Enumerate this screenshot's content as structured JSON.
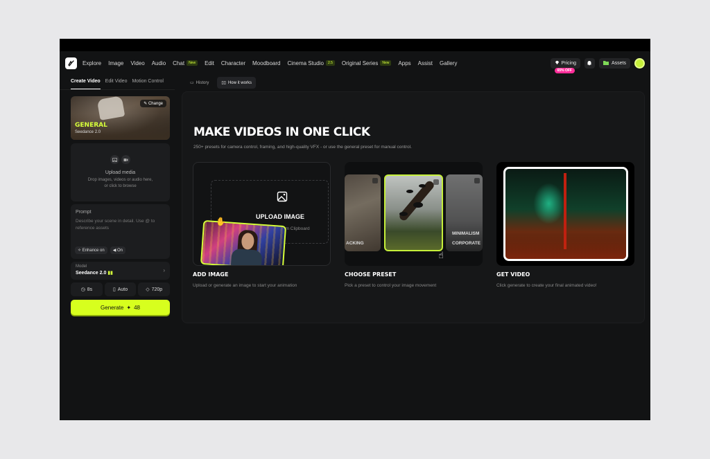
{
  "nav": {
    "items": [
      {
        "label": "Explore"
      },
      {
        "label": "Image"
      },
      {
        "label": "Video"
      },
      {
        "label": "Audio"
      },
      {
        "label": "Chat",
        "badge": "New"
      },
      {
        "label": "Edit"
      },
      {
        "label": "Character"
      },
      {
        "label": "Moodboard"
      },
      {
        "label": "Cinema Studio",
        "badge": "2.5"
      },
      {
        "label": "Original Series",
        "badge": "New"
      },
      {
        "label": "Apps"
      },
      {
        "label": "Assist"
      },
      {
        "label": "Gallery"
      }
    ],
    "pricing_label": "Pricing",
    "pricing_badge": "65% OFF",
    "assets_label": "Assets"
  },
  "sidebar": {
    "tabs": [
      "Create Video",
      "Edit Video",
      "Motion Control"
    ],
    "preset": {
      "change_label": "Change",
      "name": "GENERAL",
      "model": "Seedance 2.0"
    },
    "upload": {
      "title": "Upload media",
      "sub1": "Drop images, videos or audio here,",
      "sub2": "or click to browse"
    },
    "prompt": {
      "label": "Prompt",
      "placeholder": "Describe your scene in detail. Use @ to reference assets",
      "enhance_label": "Enhance on",
      "toggle_label": "On"
    },
    "model": {
      "label": "Model",
      "value": "Seedance 2.0"
    },
    "options": {
      "duration": "8s",
      "aspect": "Auto",
      "resolution": "720p"
    },
    "generate": {
      "label": "Generate",
      "cost": "48"
    }
  },
  "toolbar": {
    "history_label": "History",
    "how_label": "How it works"
  },
  "hero": {
    "title": "MAKE VIDEOS IN ONE CLICK",
    "subtitle": "250+ presets for camera control, framing, and high-quality VFX - or use the general preset for manual control."
  },
  "steps": {
    "upload": {
      "card_title": "UPLOAD IMAGE",
      "card_sub": "from Clipboard",
      "title": "ADD IMAGE",
      "sub": "Upload or generate an image to start your animation"
    },
    "preset": {
      "left_label": "ACKING",
      "right_label1": "MINIMALISM",
      "right_label2": "CORPORATE",
      "title": "CHOOSE PRESET",
      "sub": "Pick a preset to control your image movement"
    },
    "video": {
      "title": "GET VIDEO",
      "sub": "Click generate to create your final animated video!"
    }
  },
  "colors": {
    "accent": "#d7ff1e",
    "pink": "#ff2e9a",
    "bg": "#121314"
  }
}
